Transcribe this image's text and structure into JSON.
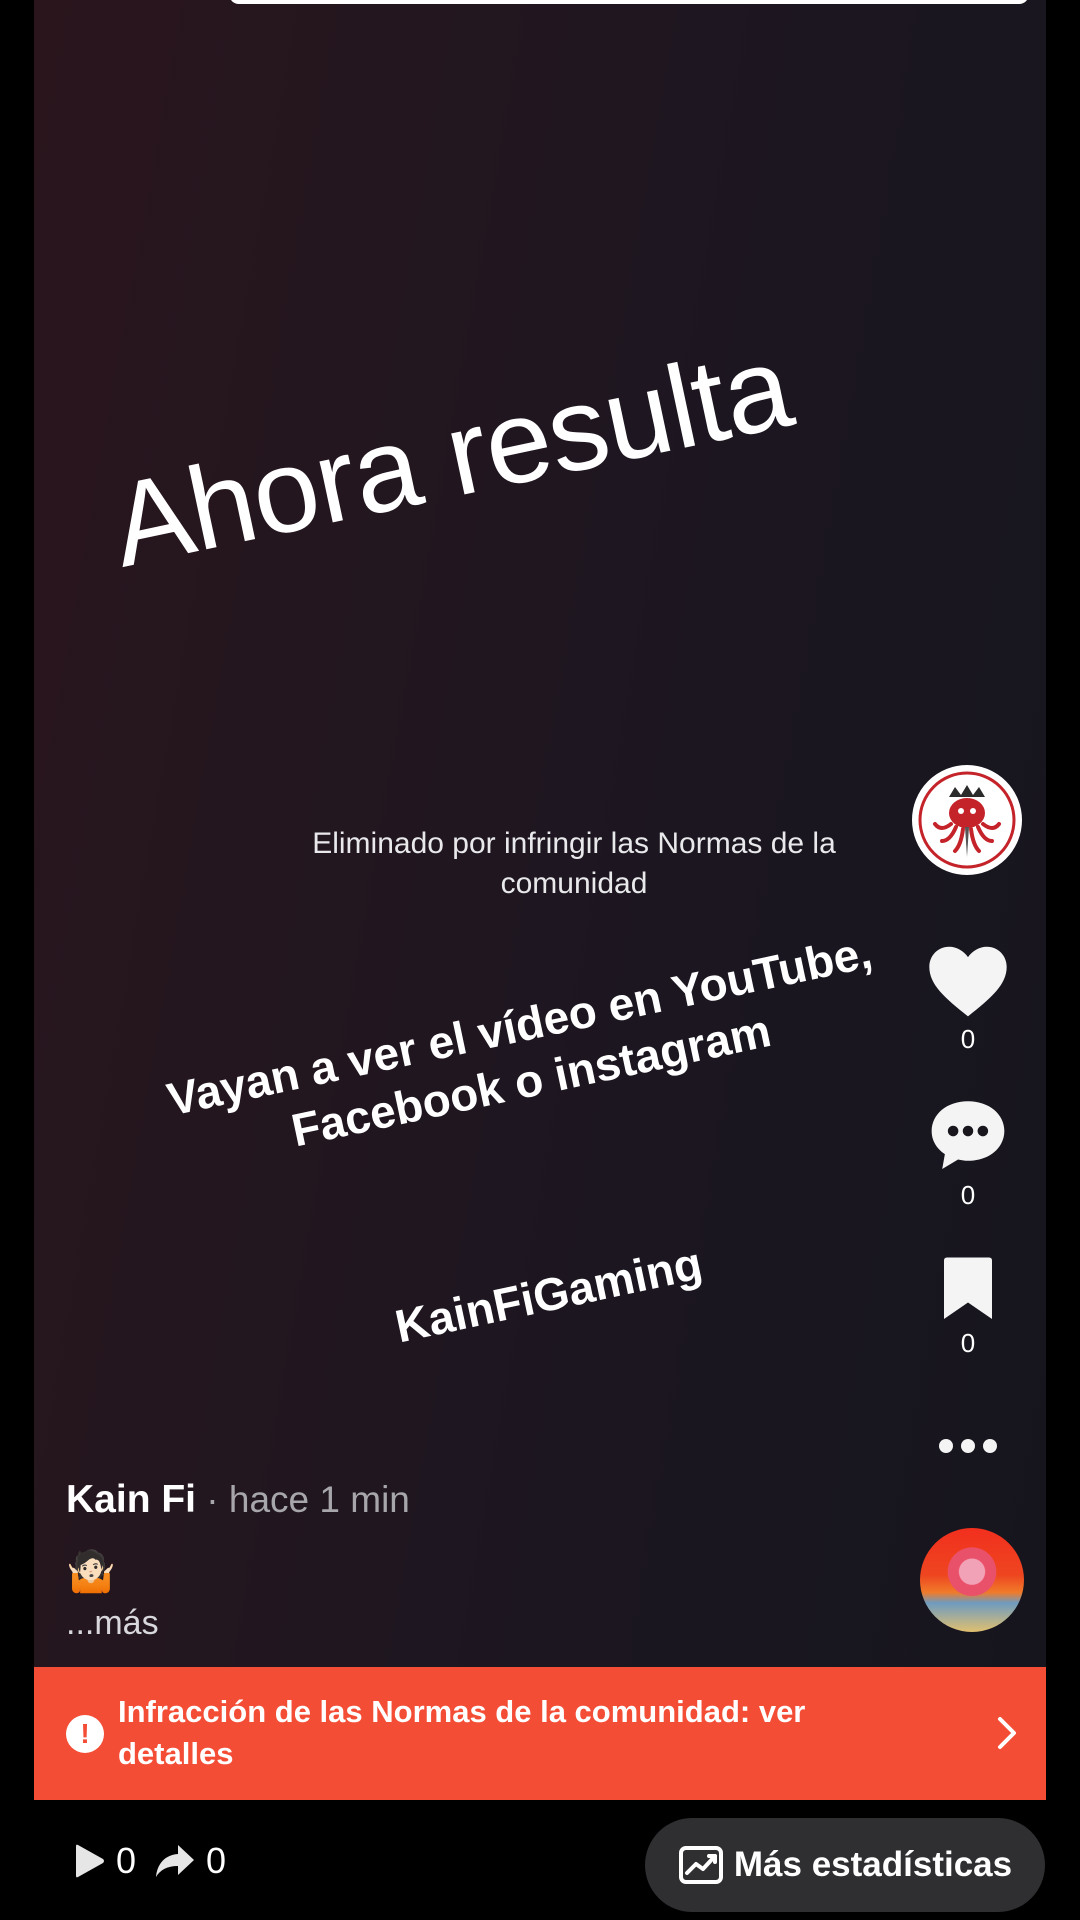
{
  "video": {
    "overlay_big": "Ahora resulta",
    "removed_notice": "Eliminado por infringir las Normas de la comunidad",
    "overlay_line1": "Vayan a ver el vídeo en YouTube,",
    "overlay_line2": "Facebook o instagram",
    "overlay_brand": "KainFiGaming"
  },
  "rail": {
    "likes": "0",
    "comments": "0",
    "saves": "0"
  },
  "caption": {
    "author": "Kain Fi",
    "time": " · hace 1 min",
    "emoji": "🤷🏻",
    "more": "...más"
  },
  "banner": {
    "text": "Infracción de las Normas de la comunidad: ver detalles"
  },
  "footer": {
    "plays": "0",
    "shares": "0",
    "stats_label": "Más estadísticas"
  },
  "colors": {
    "banner": "#f44d36",
    "stats_button": "#2f2f32"
  }
}
